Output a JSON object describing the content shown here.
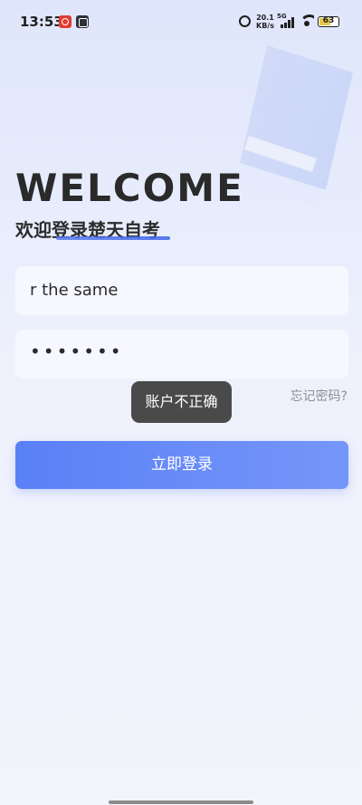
{
  "status_bar": {
    "time": "13:53",
    "net_speed_value": "20.1",
    "net_speed_unit": "KB/s",
    "network": "5G",
    "battery": "63",
    "battery_level_percent": 63,
    "icons": [
      "notification-app-icon",
      "notification-app-icon-2",
      "alarm-icon",
      "signal-icon",
      "wifi-icon",
      "battery-icon"
    ]
  },
  "header": {
    "welcome": "WELCOME",
    "subtitle": "欢迎登录楚天自考"
  },
  "form": {
    "account_value": "r the same",
    "password_value": "•••••••",
    "forgot_password": "忘记密码?",
    "login_button": "立即登录"
  },
  "toast": {
    "message": "账户不正确"
  },
  "colors": {
    "accent": "#5a80f6",
    "toast_bg": "#3c3c3c",
    "battery_fill": "#e8c84a"
  }
}
